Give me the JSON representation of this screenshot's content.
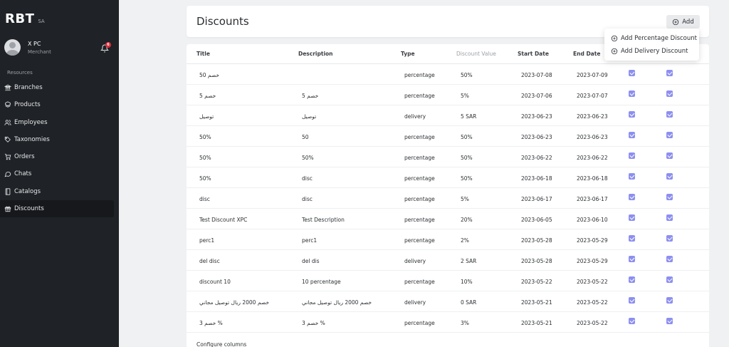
{
  "brand": {
    "name": "RBT",
    "sub": "SA"
  },
  "user": {
    "name": "X PC",
    "role": "Merchant",
    "notifications": "6"
  },
  "sidebar": {
    "section": "Resources",
    "items": [
      {
        "label": "Branches",
        "icon": "bank-icon"
      },
      {
        "label": "Products",
        "icon": "cubes-icon"
      },
      {
        "label": "Employees",
        "icon": "users-icon"
      },
      {
        "label": "Taxonomies",
        "icon": "tag-icon"
      },
      {
        "label": "Orders",
        "icon": "cart-icon"
      },
      {
        "label": "Chats",
        "icon": "chat-icon"
      },
      {
        "label": "Catalogs",
        "icon": "book-icon"
      },
      {
        "label": "Discounts",
        "icon": "gift-icon"
      }
    ],
    "active_index": 7
  },
  "header": {
    "title": "Discounts",
    "add_label": "Add"
  },
  "dropdown": {
    "items": [
      "Add Percentage Discount",
      "Add Delivery Discount"
    ]
  },
  "table": {
    "columns": [
      "Title",
      "Description",
      "Type",
      "Discount Value",
      "Start Date",
      "End Date"
    ],
    "rows": [
      [
        "خصم 50",
        "",
        "percentage",
        "50%",
        "2023-07-08",
        "2023-07-09"
      ],
      [
        "خصم 5",
        "خصم 5",
        "percentage",
        "5%",
        "2023-07-06",
        "2023-07-07"
      ],
      [
        "توصيل",
        "توصيل",
        "delivery",
        "5 SAR",
        "2023-06-23",
        "2023-06-23"
      ],
      [
        "50%",
        "50",
        "percentage",
        "50%",
        "2023-06-23",
        "2023-06-23"
      ],
      [
        "50%",
        "50%",
        "percentage",
        "50%",
        "2023-06-22",
        "2023-06-22"
      ],
      [
        "50%",
        "disc",
        "percentage",
        "50%",
        "2023-06-18",
        "2023-06-18"
      ],
      [
        "disc",
        "disc",
        "percentage",
        "5%",
        "2023-06-17",
        "2023-06-17"
      ],
      [
        "Test Discount XPC",
        "Test Description",
        "percentage",
        "20%",
        "2023-06-05",
        "2023-06-10"
      ],
      [
        "perc1",
        "perc1",
        "percentage",
        "2%",
        "2023-05-28",
        "2023-05-29"
      ],
      [
        "del disc",
        "del dis",
        "delivery",
        "2 SAR",
        "2023-05-28",
        "2023-05-29"
      ],
      [
        "discount 10",
        "10 percentage",
        "percentage",
        "10%",
        "2023-05-22",
        "2023-05-22"
      ],
      [
        "خصم 2000 ريال توصيل مجاني",
        "خصم 2000 ريال توصيل مجاني",
        "delivery",
        "0 SAR",
        "2023-05-21",
        "2023-05-22"
      ],
      [
        "خصم 3 %",
        "خصم 3 %",
        "percentage",
        "3%",
        "2023-05-21",
        "2023-05-22"
      ]
    ],
    "configure_label": "Configure columns"
  },
  "colors": {
    "sidebar_bg": "#1f2226",
    "checkbox": "#8c8ff0",
    "badge": "#dc2f3b"
  }
}
